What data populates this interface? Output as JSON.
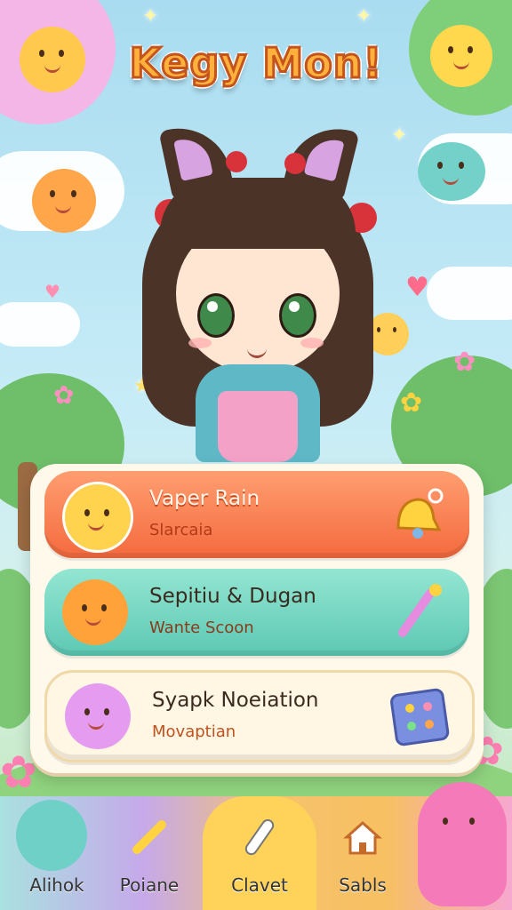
{
  "title": "Kegy Mon!",
  "menu": {
    "items": [
      {
        "label": "Vaper Rain",
        "sub": "Slarcaia",
        "left_icon": "star-face-icon",
        "right_icon": "bell-key-icon"
      },
      {
        "label": "Sepitiu & Dugan",
        "sub": "Wante Scoon",
        "left_icon": "fox-face-icon",
        "right_icon": "wand-icon"
      },
      {
        "label": "Syapk Noeiation",
        "sub": "Movaptian",
        "left_icon": "purple-cat-icon",
        "right_icon": "puzzle-board-icon"
      }
    ]
  },
  "nav": {
    "items": [
      {
        "label": "Alihok",
        "icon": "teal-bunny-icon"
      },
      {
        "label": "Poiane",
        "icon": "bone-icon"
      },
      {
        "label": "Clavet",
        "icon": "bandage-icon"
      },
      {
        "label": "Sabls",
        "icon": "home-icon"
      }
    ],
    "active_index": 2
  },
  "colors": {
    "card1": "#ff8a5b",
    "card2": "#7ed9c3",
    "card3": "#fff6e3",
    "accent": "#ffb13b"
  }
}
